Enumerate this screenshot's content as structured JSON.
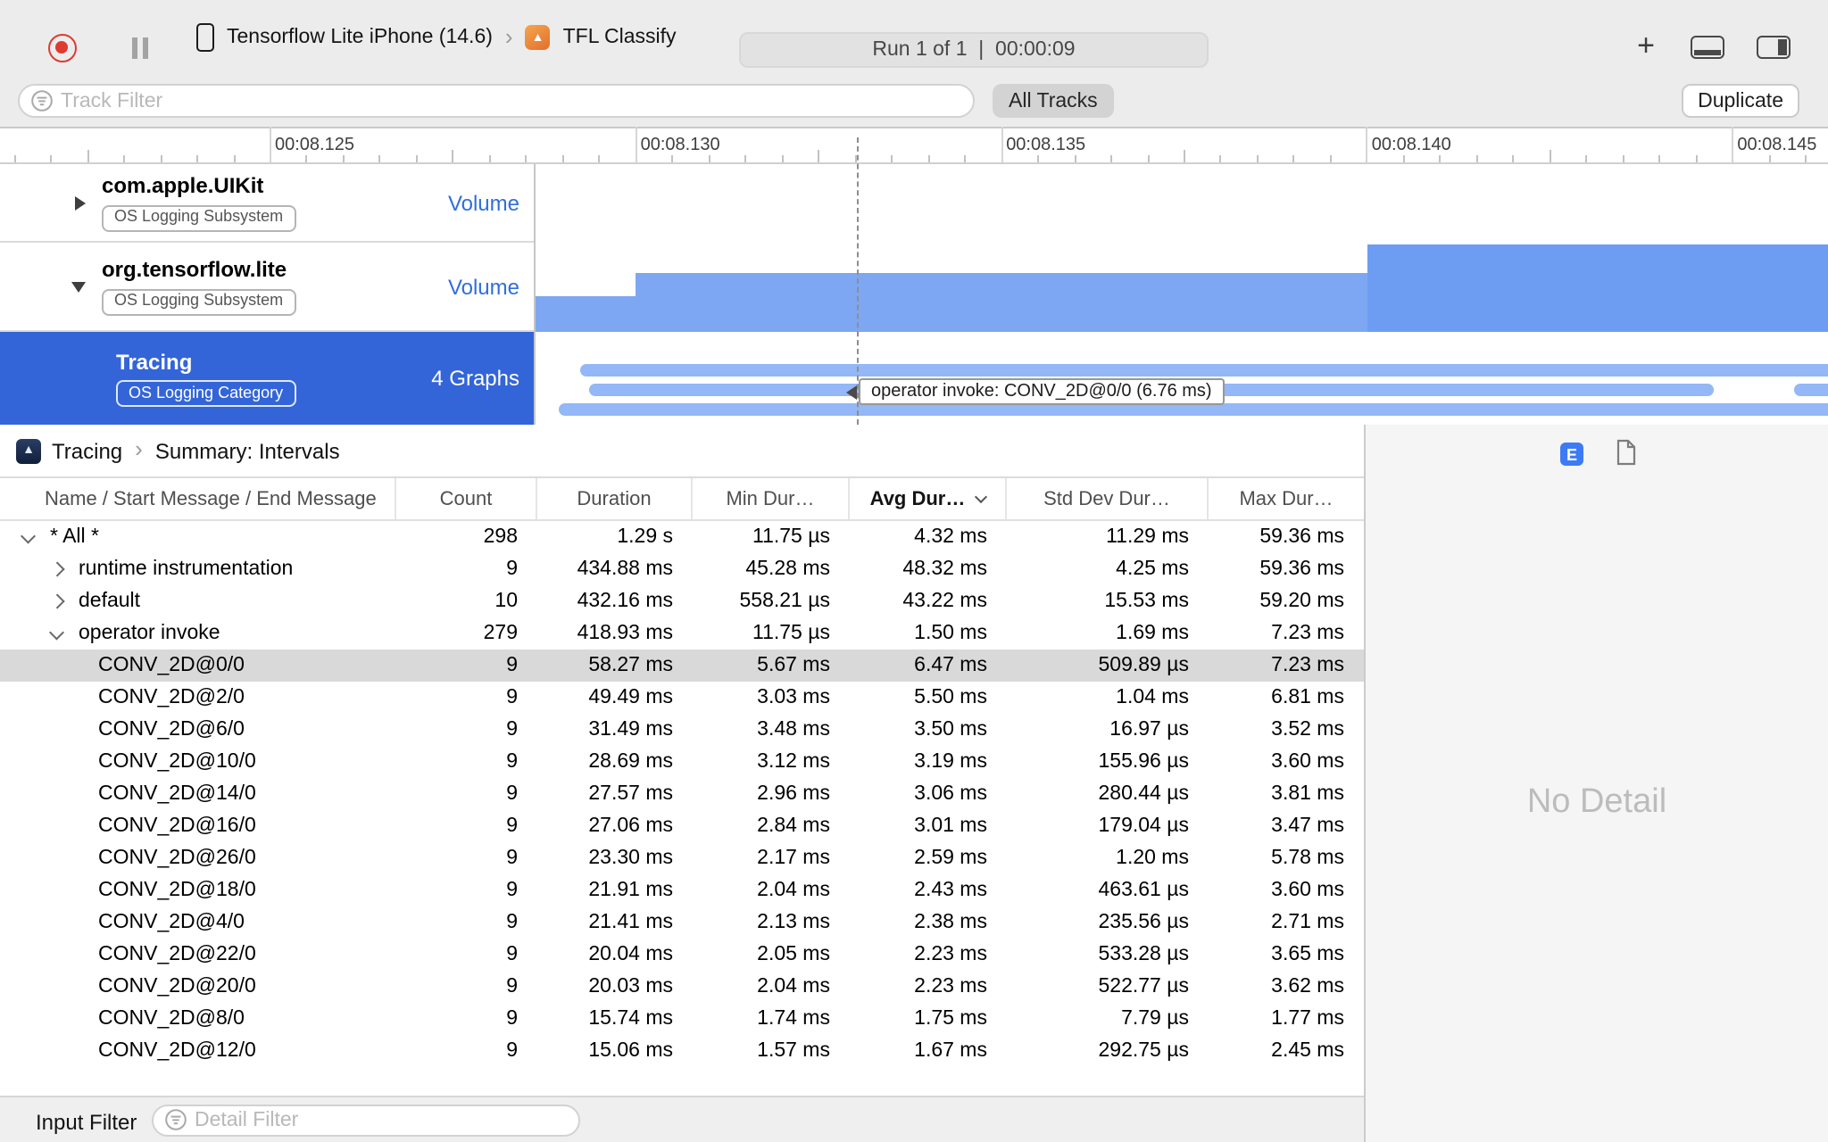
{
  "colors": {
    "accent_blue": "#3365d9",
    "chart_blue": "#7da7f2",
    "chart_blue_dark": "#6d9df3",
    "bar_blue": "#93b7f7",
    "volume_blue": "#2f6ee0",
    "selected_gray": "#d9d9d9",
    "e_blue": "#3d7bf5",
    "record_red": "#dd3b30"
  },
  "icons": {
    "plus": "+",
    "chevron_right": "›"
  },
  "toolbar": {
    "device": "Tensorflow Lite iPhone (14.6)",
    "target": "TFL Classify",
    "run_info": "Run 1 of 1  |  00:00:09"
  },
  "filter_bar": {
    "track_filter_placeholder": "Track Filter",
    "all_tracks_label": "All Tracks",
    "duplicate_label": "Duplicate"
  },
  "ruler": {
    "labels": [
      "00:08.125",
      "00:08.130",
      "00:08.135",
      "00:08.140",
      "00:08.145"
    ]
  },
  "tracks": [
    {
      "name": "com.apple.UIKit",
      "badge": "OS Logging Subsystem",
      "meta": "Volume",
      "disclosure": "collapsed"
    },
    {
      "name": "org.tensorflow.lite",
      "badge": "OS Logging Subsystem",
      "meta": "Volume",
      "disclosure": "expanded"
    },
    {
      "name": "Tracing",
      "badge": "OS Logging Category",
      "meta": "4 Graphs",
      "selected": true
    }
  ],
  "tooltip": "operator invoke: CONV_2D@0/0 (6.76 ms)",
  "breadcrumb": {
    "items": [
      "Tracing",
      "Summary: Intervals"
    ],
    "separator": "›"
  },
  "detail_panel": {
    "e_badge": "E",
    "no_detail": "No Detail"
  },
  "table": {
    "columns": [
      "Name / Start Message / End Message",
      "Count",
      "Duration",
      "Min Dur…",
      "Avg Dur…",
      "Std Dev Dur…",
      "Max Dur…"
    ],
    "sorted_column": "Avg Dur…",
    "rows": [
      {
        "name": "* All *",
        "level": 0,
        "disclosure": "down",
        "count": "298",
        "duration": "1.29 s",
        "min": "11.75 µs",
        "avg": "4.32 ms",
        "std": "11.29 ms",
        "max": "59.36 ms"
      },
      {
        "name": "runtime instrumentation",
        "level": 1,
        "disclosure": "right",
        "count": "9",
        "duration": "434.88 ms",
        "min": "45.28 ms",
        "avg": "48.32 ms",
        "std": "4.25 ms",
        "max": "59.36 ms"
      },
      {
        "name": "default",
        "level": 1,
        "disclosure": "right",
        "count": "10",
        "duration": "432.16 ms",
        "min": "558.21 µs",
        "avg": "43.22 ms",
        "std": "15.53 ms",
        "max": "59.20 ms"
      },
      {
        "name": "operator invoke",
        "level": 1,
        "disclosure": "down",
        "count": "279",
        "duration": "418.93 ms",
        "min": "11.75 µs",
        "avg": "1.50 ms",
        "std": "1.69 ms",
        "max": "7.23 ms"
      },
      {
        "name": "CONV_2D@0/0",
        "level": 2,
        "selected": true,
        "count": "9",
        "duration": "58.27 ms",
        "min": "5.67 ms",
        "avg": "6.47 ms",
        "std": "509.89 µs",
        "max": "7.23 ms"
      },
      {
        "name": "CONV_2D@2/0",
        "level": 2,
        "count": "9",
        "duration": "49.49 ms",
        "min": "3.03 ms",
        "avg": "5.50 ms",
        "std": "1.04 ms",
        "max": "6.81 ms"
      },
      {
        "name": "CONV_2D@6/0",
        "level": 2,
        "count": "9",
        "duration": "31.49 ms",
        "min": "3.48 ms",
        "avg": "3.50 ms",
        "std": "16.97 µs",
        "max": "3.52 ms"
      },
      {
        "name": "CONV_2D@10/0",
        "level": 2,
        "count": "9",
        "duration": "28.69 ms",
        "min": "3.12 ms",
        "avg": "3.19 ms",
        "std": "155.96 µs",
        "max": "3.60 ms"
      },
      {
        "name": "CONV_2D@14/0",
        "level": 2,
        "count": "9",
        "duration": "27.57 ms",
        "min": "2.96 ms",
        "avg": "3.06 ms",
        "std": "280.44 µs",
        "max": "3.81 ms"
      },
      {
        "name": "CONV_2D@16/0",
        "level": 2,
        "count": "9",
        "duration": "27.06 ms",
        "min": "2.84 ms",
        "avg": "3.01 ms",
        "std": "179.04 µs",
        "max": "3.47 ms"
      },
      {
        "name": "CONV_2D@26/0",
        "level": 2,
        "count": "9",
        "duration": "23.30 ms",
        "min": "2.17 ms",
        "avg": "2.59 ms",
        "std": "1.20 ms",
        "max": "5.78 ms"
      },
      {
        "name": "CONV_2D@18/0",
        "level": 2,
        "count": "9",
        "duration": "21.91 ms",
        "min": "2.04 ms",
        "avg": "2.43 ms",
        "std": "463.61 µs",
        "max": "3.60 ms"
      },
      {
        "name": "CONV_2D@4/0",
        "level": 2,
        "count": "9",
        "duration": "21.41 ms",
        "min": "2.13 ms",
        "avg": "2.38 ms",
        "std": "235.56 µs",
        "max": "2.71 ms"
      },
      {
        "name": "CONV_2D@22/0",
        "level": 2,
        "count": "9",
        "duration": "20.04 ms",
        "min": "2.05 ms",
        "avg": "2.23 ms",
        "std": "533.28 µs",
        "max": "3.65 ms"
      },
      {
        "name": "CONV_2D@20/0",
        "level": 2,
        "count": "9",
        "duration": "20.03 ms",
        "min": "2.04 ms",
        "avg": "2.23 ms",
        "std": "522.77 µs",
        "max": "3.62 ms"
      },
      {
        "name": "CONV_2D@8/0",
        "level": 2,
        "count": "9",
        "duration": "15.74 ms",
        "min": "1.74 ms",
        "avg": "1.75 ms",
        "std": "7.79 µs",
        "max": "1.77 ms"
      },
      {
        "name": "CONV_2D@12/0",
        "level": 2,
        "count": "9",
        "duration": "15.06 ms",
        "min": "1.57 ms",
        "avg": "1.67 ms",
        "std": "292.75 µs",
        "max": "2.45 ms"
      }
    ]
  },
  "bottom_bar": {
    "label": "Input Filter",
    "detail_filter_placeholder": "Detail Filter"
  }
}
